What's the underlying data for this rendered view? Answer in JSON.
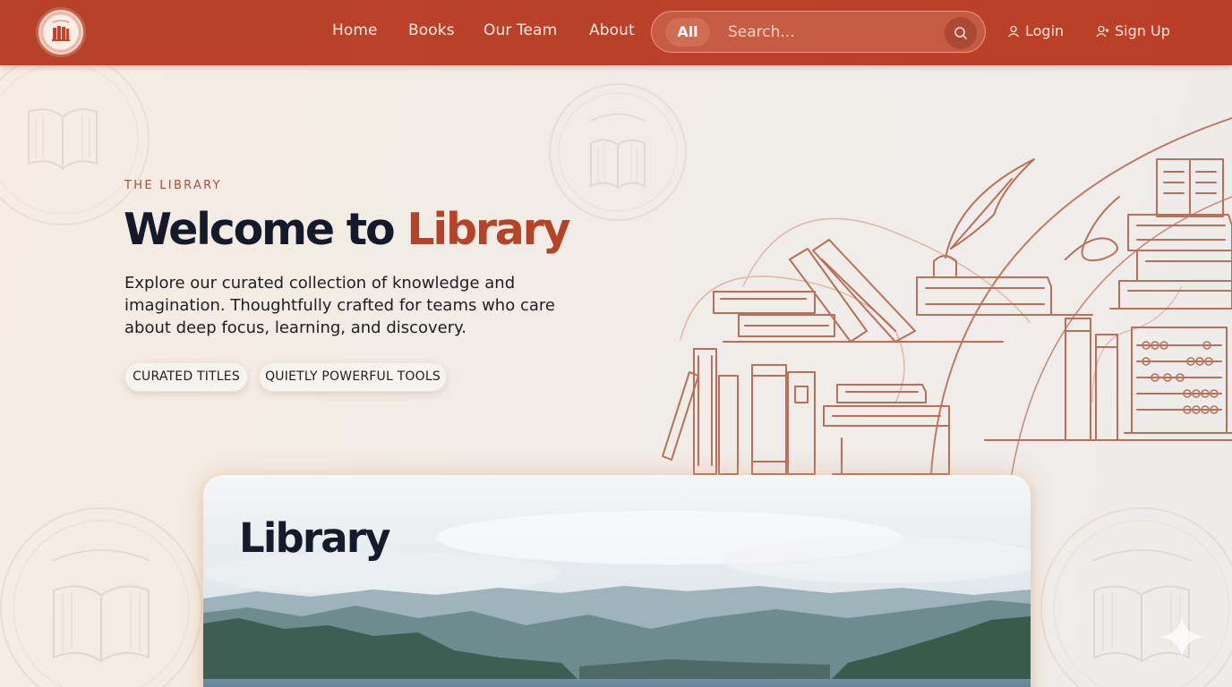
{
  "nav": {
    "links": [
      "Home",
      "Books",
      "Our Team",
      "About"
    ],
    "search": {
      "filter": "All",
      "placeholder": "Search..."
    },
    "login": "Login",
    "signup": "Sign Up"
  },
  "hero": {
    "eyebrow": "THE LIBRARY",
    "title_part1": "Welcome to ",
    "title_accent": "Library",
    "description": "Explore our curated collection of knowledge and imagination. Thoughtfully crafted for teams who care about deep focus, learning, and discovery.",
    "pills": [
      "CURATED TITLES",
      "QUIETLY POWERFUL TOOLS"
    ]
  },
  "card": {
    "title": "Library"
  },
  "seal_text": "THE LIBRARY",
  "colors": {
    "nav": "#bb4129",
    "accent": "#b54327",
    "heading": "#141a2a",
    "line_art": "#b87058"
  },
  "icons": [
    "logo-icon",
    "search-icon",
    "user-icon",
    "user-plus-icon",
    "sparkle-icon"
  ]
}
